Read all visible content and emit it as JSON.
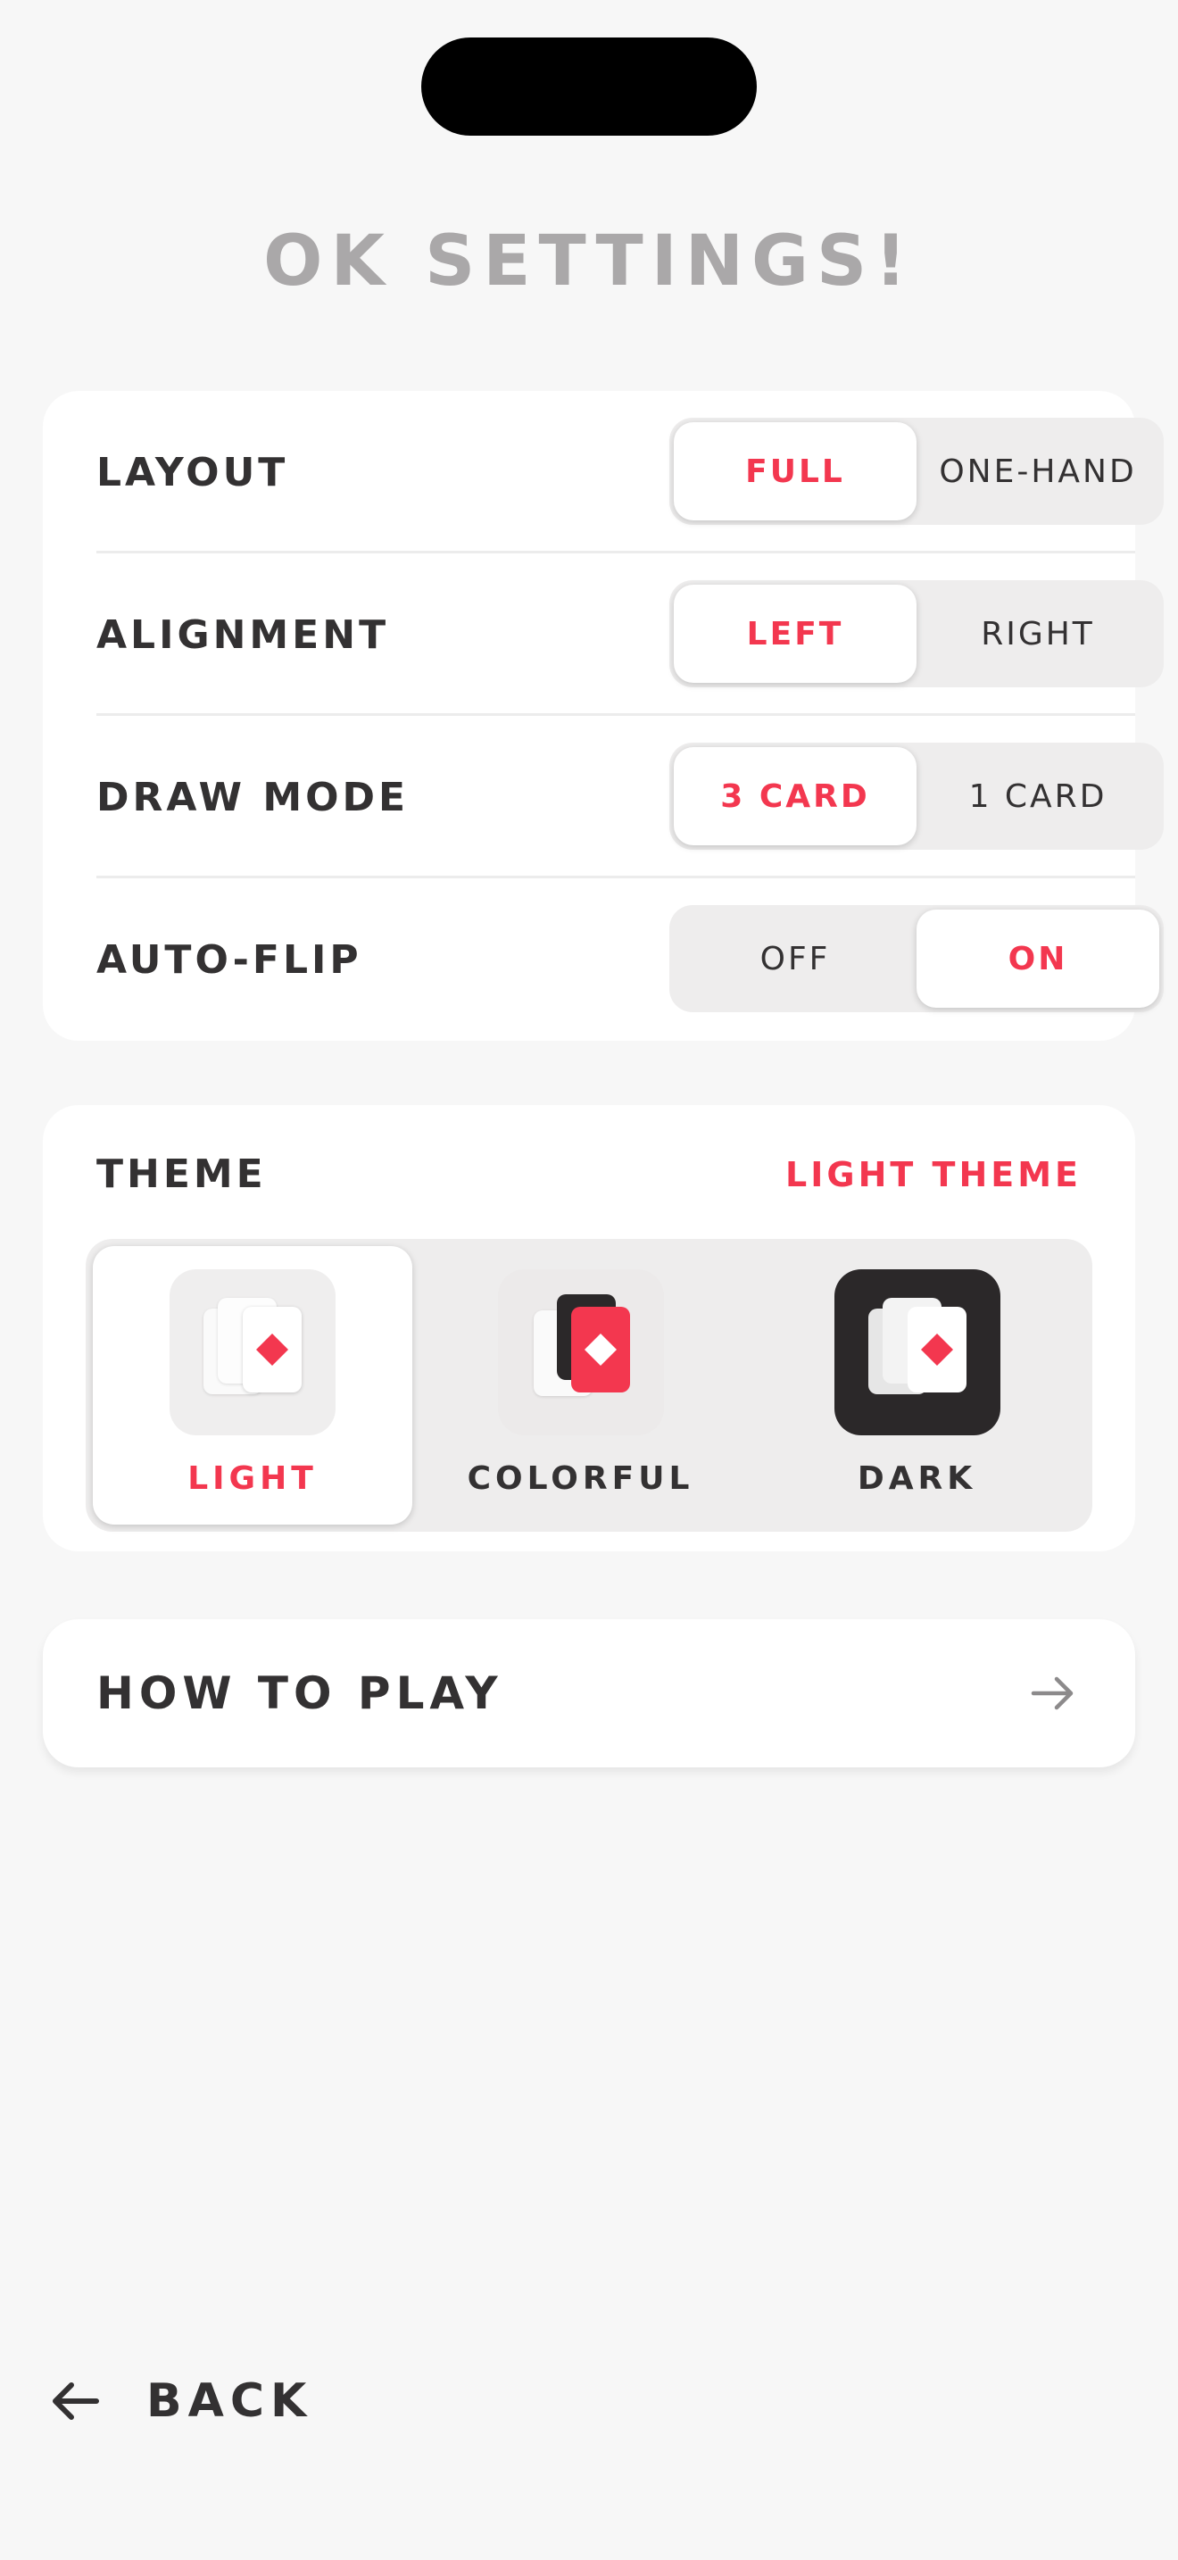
{
  "header": {
    "title": "OK SETTINGS!"
  },
  "settings": {
    "layout": {
      "label": "LAYOUT",
      "options": [
        "FULL",
        "ONE-HAND"
      ],
      "selected": "FULL"
    },
    "alignment": {
      "label": "ALIGNMENT",
      "options": [
        "LEFT",
        "RIGHT"
      ],
      "selected": "LEFT"
    },
    "draw_mode": {
      "label": "DRAW MODE",
      "options": [
        "3 CARD",
        "1 CARD"
      ],
      "selected": "3 CARD"
    },
    "auto_flip": {
      "label": "AUTO-FLIP",
      "options": [
        "OFF",
        "ON"
      ],
      "selected": "ON"
    }
  },
  "theme": {
    "label": "THEME",
    "current": "LIGHT THEME",
    "options": [
      {
        "name": "LIGHT",
        "icon": "light-theme-icon",
        "selected": true
      },
      {
        "name": "COLORFUL",
        "icon": "colorful-theme-icon",
        "selected": false
      },
      {
        "name": "DARK",
        "icon": "dark-theme-icon",
        "selected": false
      }
    ]
  },
  "howto": {
    "label": "HOW TO PLAY",
    "icon": "arrow-right-icon"
  },
  "footer": {
    "back_label": "BACK",
    "icon": "arrow-left-icon"
  },
  "colors": {
    "accent": "#f3374f",
    "text": "#333132",
    "title": "#aaa8a9",
    "background": "#f7f7f7",
    "dark": "#2b2829"
  }
}
